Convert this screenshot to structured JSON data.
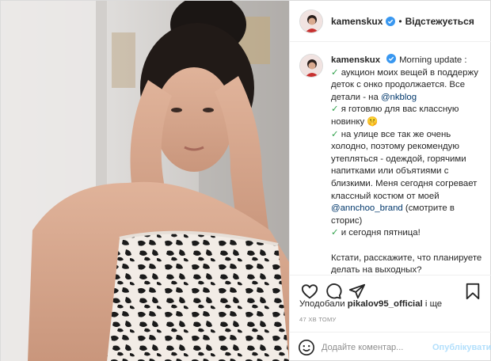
{
  "header": {
    "username": "kamenskux",
    "separator": "•",
    "follow_label": "Відстежується"
  },
  "caption": {
    "username": "kamenskux",
    "lines": [
      {
        "check": "",
        "parts": [
          {
            "t": "Morning update :"
          }
        ]
      },
      {
        "check": "✓",
        "parts": [
          {
            "t": " аукцион моих вещей в поддержу"
          }
        ]
      },
      {
        "check": "",
        "parts": [
          {
            "t": "деток с онко продолжается. Все"
          }
        ]
      },
      {
        "check": "",
        "parts": [
          {
            "t": "детали - на "
          },
          {
            "t": "@nkblog",
            "m": true
          }
        ]
      },
      {
        "check": "✓",
        "parts": [
          {
            "t": " я готовлю для вас классную"
          }
        ]
      },
      {
        "check": "",
        "parts": [
          {
            "t": "новинку 🤫"
          }
        ]
      },
      {
        "check": "✓",
        "parts": [
          {
            "t": " на улице все так же очень"
          }
        ]
      },
      {
        "check": "",
        "parts": [
          {
            "t": "холодно, поэтому рекомендую"
          }
        ]
      },
      {
        "check": "",
        "parts": [
          {
            "t": "утепляться - одеждой, горячими"
          }
        ]
      },
      {
        "check": "",
        "parts": [
          {
            "t": "напитками или объятиями с"
          }
        ]
      },
      {
        "check": "",
        "parts": [
          {
            "t": "близкими. Меня сегодня согревает"
          }
        ]
      },
      {
        "check": "",
        "parts": [
          {
            "t": "классный костюм от моей"
          }
        ]
      },
      {
        "check": "",
        "parts": [
          {
            "t": "@annchoo_brand",
            "m": true
          },
          {
            "t": " (смотрите в"
          }
        ]
      },
      {
        "check": "",
        "parts": [
          {
            "t": "сторис)"
          }
        ]
      },
      {
        "check": "✓",
        "parts": [
          {
            "t": " и сегодня пятница!"
          }
        ]
      },
      {
        "check": "",
        "parts": [
          {
            "t": ""
          }
        ]
      },
      {
        "check": "",
        "parts": [
          {
            "t": "Кстати, расскажите, что планируете"
          }
        ]
      },
      {
        "check": "",
        "parts": [
          {
            "t": "делать на выходных?"
          }
        ]
      }
    ]
  },
  "actions": {
    "icons": [
      "heart-icon",
      "comment-icon",
      "share-icon",
      "bookmark-icon"
    ]
  },
  "likes": {
    "prefix": "Уподобали ",
    "user": "pikalov95_official",
    "suffix": " і ще"
  },
  "timestamp": "47 хв тому",
  "add_comment": {
    "placeholder": "Додайте коментар...",
    "publish_label": "Опублікувати"
  },
  "colors": {
    "verified": "#3897f0",
    "check": "#31a24c",
    "mention": "#00376b",
    "publish_disabled": "#b2dffc"
  }
}
